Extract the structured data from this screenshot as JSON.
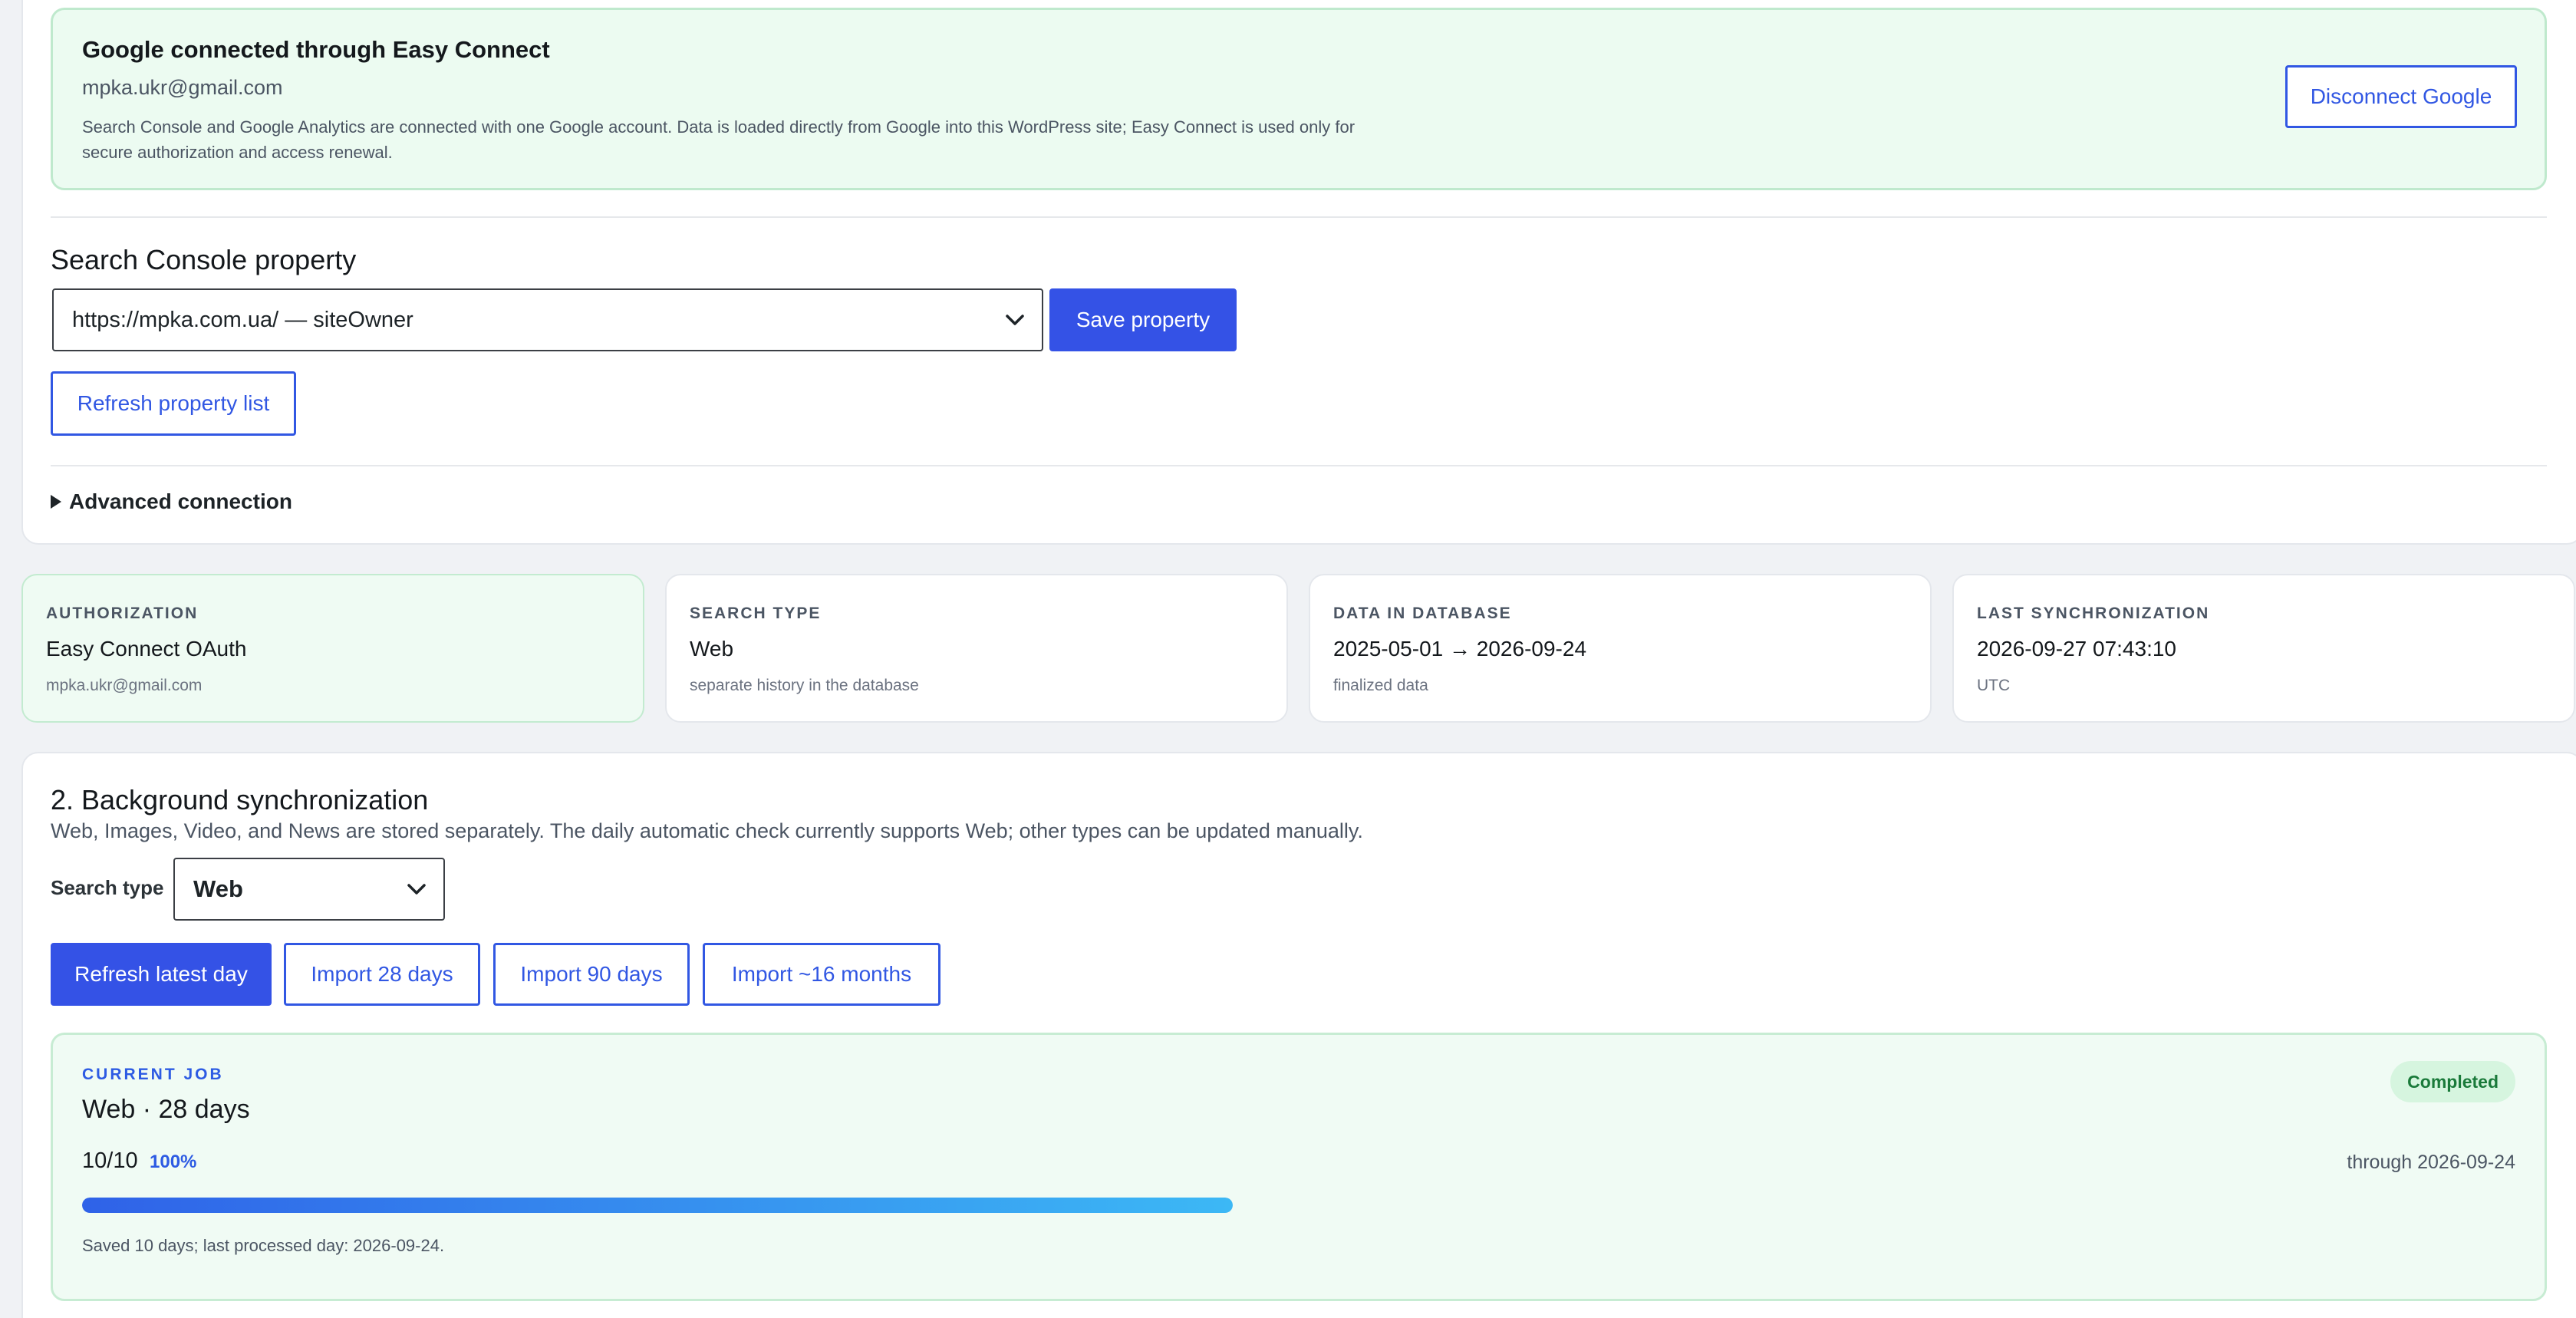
{
  "google_connection": {
    "title": "Google connected through Easy Connect",
    "email": "mpka.ukr@gmail.com",
    "description": "Search Console and Google Analytics are connected with one Google account. Data is loaded directly from Google into this WordPress site; Easy Connect is used only for secure authorization and access renewal.",
    "disconnect_label": "Disconnect Google"
  },
  "property": {
    "section_title": "Search Console property",
    "selected": "https://mpka.com.ua/ — siteOwner",
    "save_label": "Save property",
    "refresh_label": "Refresh property list",
    "advanced_label": "Advanced connection"
  },
  "status_cards": [
    {
      "label": "AUTHORIZATION",
      "value": "Easy Connect OAuth",
      "sub": "mpka.ukr@gmail.com"
    },
    {
      "label": "SEARCH TYPE",
      "value": "Web",
      "sub": "separate history in the database"
    },
    {
      "label": "DATA IN DATABASE",
      "value": "2025-05-01 → 2026-09-24",
      "sub": "finalized data"
    },
    {
      "label": "LAST SYNCHRONIZATION",
      "value": "2026-09-27 07:43:10",
      "sub": "UTC"
    }
  ],
  "sync": {
    "section_title": "2. Background synchronization",
    "description": "Web, Images, Video, and News are stored separately. The daily automatic check currently supports Web; other types can be updated manually.",
    "search_type_label": "Search type",
    "search_type_selected": "Web",
    "buttons": {
      "refresh_latest": "Refresh latest day",
      "import_28": "Import 28 days",
      "import_90": "Import 90 days",
      "import_16m": "Import ~16 months"
    }
  },
  "current_job": {
    "label": "CURRENT JOB",
    "title": "Web · 28 days",
    "status": "Completed",
    "count": "10/10",
    "percent_text": "100%",
    "progress_fraction": 1.0,
    "through": "through 2026-09-24",
    "note": "Saved 10 days; last processed day: 2026-09-24."
  },
  "colors": {
    "accent": "#3452e6",
    "success_bg": "#ecfbf1",
    "success_text": "#1a7a3a"
  },
  "icons": {
    "select_chevron": "chevron-down-icon",
    "advanced_toggle": "triangle-right-icon"
  }
}
